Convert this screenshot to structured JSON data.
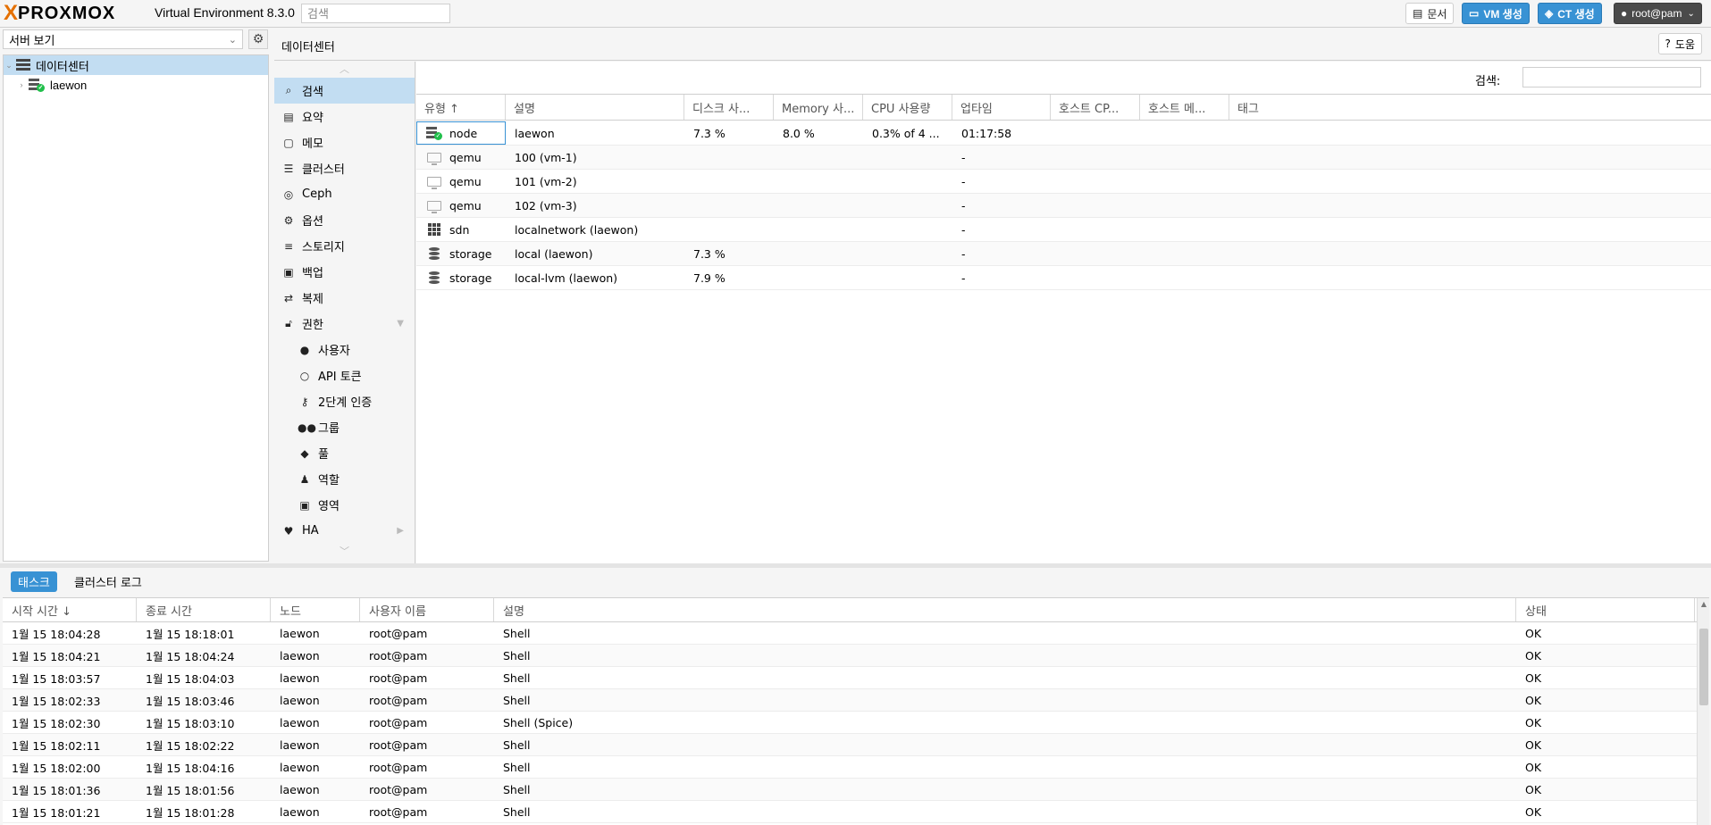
{
  "header": {
    "logo_prefix": "X",
    "logo_text": "PROXMOX",
    "version": "Virtual Environment 8.3.0",
    "search_placeholder": "검색",
    "docs_label": "문서",
    "create_vm_label": "VM 생성",
    "create_ct_label": "CT 생성",
    "user_label": "root@pam"
  },
  "tree": {
    "view_select": "서버 보기",
    "items": [
      {
        "label": "데이터센터"
      },
      {
        "label": "laewon"
      }
    ]
  },
  "content": {
    "title": "데이터센터",
    "help_label": "도움"
  },
  "menu": {
    "items": [
      {
        "label": "검색",
        "icon": "search-icon"
      },
      {
        "label": "요약",
        "icon": "book-icon"
      },
      {
        "label": "메모",
        "icon": "note-icon"
      },
      {
        "label": "클러스터",
        "icon": "server-icon"
      },
      {
        "label": "Ceph",
        "icon": "ceph-icon"
      },
      {
        "label": "옵션",
        "icon": "gear-icon"
      },
      {
        "label": "스토리지",
        "icon": "database-icon"
      },
      {
        "label": "백업",
        "icon": "floppy-icon"
      },
      {
        "label": "복제",
        "icon": "retweet-icon"
      },
      {
        "label": "권한",
        "icon": "unlock-icon"
      },
      {
        "label": "사용자",
        "icon": "user-icon"
      },
      {
        "label": "API 토큰",
        "icon": "user-outline-icon"
      },
      {
        "label": "2단계 인증",
        "icon": "key-icon"
      },
      {
        "label": "그룹",
        "icon": "users-icon"
      },
      {
        "label": "풀",
        "icon": "tags-icon"
      },
      {
        "label": "역할",
        "icon": "male-icon"
      },
      {
        "label": "영역",
        "icon": "id-badge-icon"
      },
      {
        "label": "HA",
        "icon": "heartbeat-icon"
      }
    ]
  },
  "resources": {
    "search_label": "검색:",
    "columns": [
      "유형 ↑",
      "설명",
      "디스크 사...",
      "Memory 사...",
      "CPU 사용량",
      "업타임",
      "호스트 CP...",
      "호스트 메...",
      "태그"
    ],
    "rows": [
      {
        "type": "node",
        "desc": "laewon",
        "disk": "7.3 %",
        "mem": "8.0 %",
        "cpu": "0.3% of 4 ...",
        "uptime": "01:17:58"
      },
      {
        "type": "qemu",
        "desc": "100 (vm-1)",
        "disk": "",
        "mem": "",
        "cpu": "",
        "uptime": "-"
      },
      {
        "type": "qemu",
        "desc": "101 (vm-2)",
        "disk": "",
        "mem": "",
        "cpu": "",
        "uptime": "-"
      },
      {
        "type": "qemu",
        "desc": "102 (vm-3)",
        "disk": "",
        "mem": "",
        "cpu": "",
        "uptime": "-"
      },
      {
        "type": "sdn",
        "desc": "localnetwork (laewon)",
        "disk": "",
        "mem": "",
        "cpu": "",
        "uptime": "-"
      },
      {
        "type": "storage",
        "desc": "local (laewon)",
        "disk": "7.3 %",
        "mem": "",
        "cpu": "",
        "uptime": "-"
      },
      {
        "type": "storage",
        "desc": "local-lvm (laewon)",
        "disk": "7.9 %",
        "mem": "",
        "cpu": "",
        "uptime": "-"
      }
    ]
  },
  "bottom": {
    "tab_tasks": "태스크",
    "tab_cluster_log": "클러스터 로그",
    "columns": [
      "시작 시간 ↓",
      "종료 시간",
      "노드",
      "사용자 이름",
      "설명",
      "상태"
    ],
    "rows": [
      {
        "start": "1월 15 18:04:28",
        "end": "1월 15 18:18:01",
        "node": "laewon",
        "user": "root@pam",
        "desc": "Shell",
        "status": "OK"
      },
      {
        "start": "1월 15 18:04:21",
        "end": "1월 15 18:04:24",
        "node": "laewon",
        "user": "root@pam",
        "desc": "Shell",
        "status": "OK"
      },
      {
        "start": "1월 15 18:03:57",
        "end": "1월 15 18:04:03",
        "node": "laewon",
        "user": "root@pam",
        "desc": "Shell",
        "status": "OK"
      },
      {
        "start": "1월 15 18:02:33",
        "end": "1월 15 18:03:46",
        "node": "laewon",
        "user": "root@pam",
        "desc": "Shell",
        "status": "OK"
      },
      {
        "start": "1월 15 18:02:30",
        "end": "1월 15 18:03:10",
        "node": "laewon",
        "user": "root@pam",
        "desc": "Shell (Spice)",
        "status": "OK"
      },
      {
        "start": "1월 15 18:02:11",
        "end": "1월 15 18:02:22",
        "node": "laewon",
        "user": "root@pam",
        "desc": "Shell",
        "status": "OK"
      },
      {
        "start": "1월 15 18:02:00",
        "end": "1월 15 18:04:16",
        "node": "laewon",
        "user": "root@pam",
        "desc": "Shell",
        "status": "OK"
      },
      {
        "start": "1월 15 18:01:36",
        "end": "1월 15 18:01:56",
        "node": "laewon",
        "user": "root@pam",
        "desc": "Shell",
        "status": "OK"
      },
      {
        "start": "1월 15 18:01:21",
        "end": "1월 15 18:01:28",
        "node": "laewon",
        "user": "root@pam",
        "desc": "Shell",
        "status": "OK"
      }
    ]
  },
  "colors": {
    "accent": "#3892d4",
    "selection": "#c2ddf2",
    "logo_orange": "#e57000",
    "status_green": "#21bf4b"
  }
}
